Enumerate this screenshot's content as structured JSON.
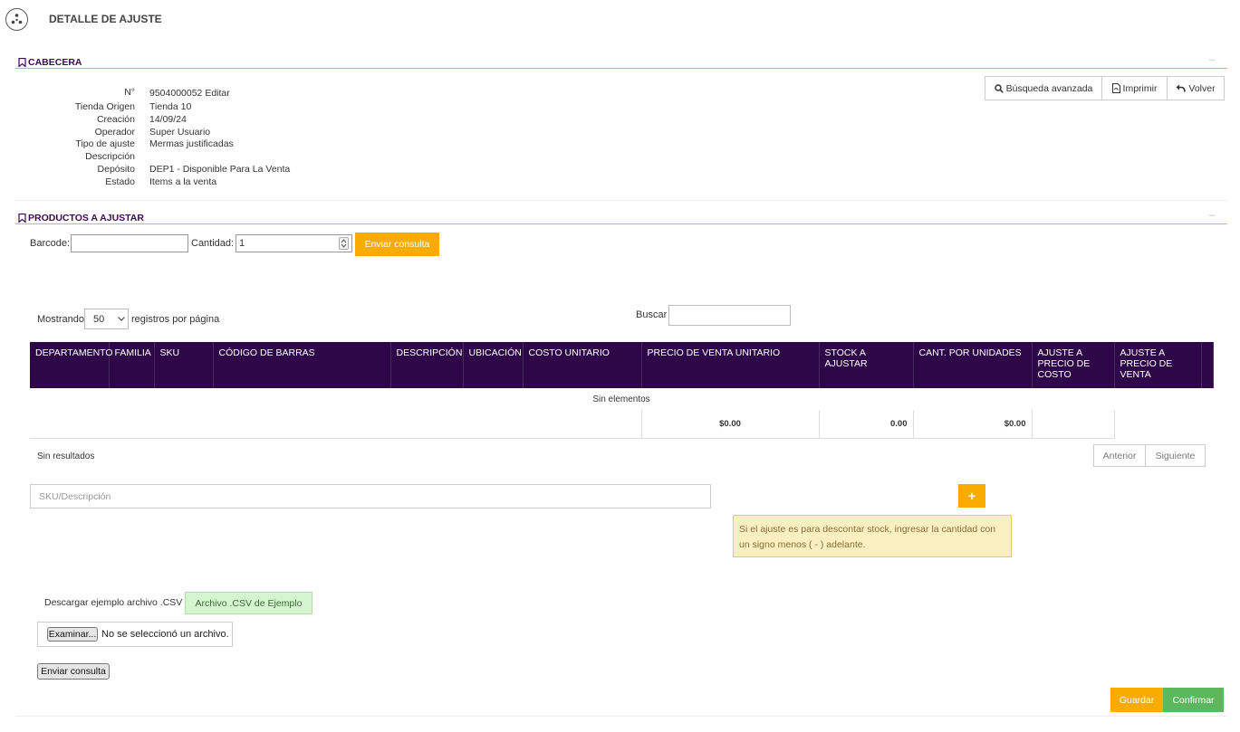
{
  "page": {
    "title": "DETALLE DE AJUSTE"
  },
  "cabecera": {
    "title": "CABECERA",
    "collapse": "–",
    "fields": [
      {
        "label": "N°",
        "value": "9504000052",
        "link": "Editar"
      },
      {
        "label": "Tienda Origen",
        "value": "Tienda 10"
      },
      {
        "label": "Creación",
        "value": "14/09/24"
      },
      {
        "label": "Operador",
        "value": "Super Usuario"
      },
      {
        "label": "Tipo de ajuste",
        "value": "Mermas justificadas"
      },
      {
        "label": "Descripción",
        "value": ""
      },
      {
        "label": "Depósito",
        "value": "DEP1 - Disponible Para La Venta"
      },
      {
        "label": "Estado",
        "value": "Items a la venta"
      }
    ],
    "actions": {
      "search": "Búsqueda avanzada",
      "print": "Imprimir",
      "back": "Volver"
    }
  },
  "productos": {
    "title": "PRODUCTOS A AJUSTAR",
    "collapse": "–",
    "form": {
      "barcode_label": "Barcode:",
      "barcode_value": "",
      "cantidad_label": "Cantidad:",
      "cantidad_value": "1",
      "submit_label": "Enviar consulta"
    },
    "table_controls": {
      "showing_label": "Mostrando",
      "page_size": "50",
      "page_size_suffix": "registros por página",
      "search_label": "Buscar",
      "search_value": ""
    },
    "table": {
      "columns": [
        "DEPARTAMENTO",
        "FAMILIA",
        "SKU",
        "CÓDIGO DE BARRAS",
        "DESCRIPCIÓN",
        "UBICACIÓN",
        "COSTO UNITARIO",
        "PRECIO DE VENTA UNITARIO",
        "STOCK A AJUSTAR",
        "CANT. POR UNIDADES",
        "AJUSTE A PRECIO DE COSTO",
        "AJUSTE A PRECIO DE VENTA"
      ],
      "empty_message": "Sin elementos",
      "totals": {
        "precio_venta": "$0.00",
        "stock": "0.00",
        "cant_unidades": "$0.00"
      }
    },
    "pagination": {
      "info": "Sin resultados",
      "prev": "Anterior",
      "next": "Siguiente"
    },
    "sku_placeholder": "SKU/Descripción",
    "add_symbol": "+",
    "alert": "Si el ajuste es para descontar stock, ingresar la cantidad con un signo menos ( - ) adelante.",
    "csv": {
      "download_label": "Descargar ejemplo archivo .CSV",
      "download_button": "Archivo .CSV de Ejemplo",
      "browse_button": "Examinar...",
      "no_file": "No se seleccionó un archivo.",
      "submit_label": "Enviar consulta"
    }
  },
  "footer": {
    "save": "Guardar",
    "confirm": "Confirmar"
  },
  "colors": {
    "header_bg": "#2e0748",
    "accent_orange": "#f8ac00",
    "accent_green": "#5cb85c",
    "section_line": "#d9c400"
  }
}
